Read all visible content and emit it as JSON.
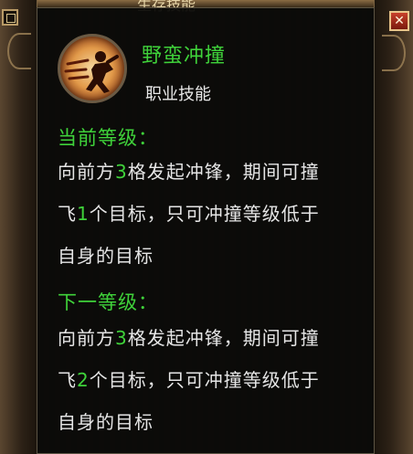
{
  "window": {
    "title_fragment": "生存技能",
    "close_glyph": "✕"
  },
  "skill": {
    "name": "野蛮冲撞",
    "type": "职业技能",
    "icon": "charging-warrior-icon"
  },
  "current_level": {
    "heading": "当前等级：",
    "desc_a": "向前方",
    "range": "3",
    "desc_b": "格发起冲锋，期间可撞",
    "desc_c": "飞",
    "targets": "1",
    "desc_d": "个目标，只可冲撞等级低于",
    "desc_e": "自身的目标"
  },
  "next_level": {
    "heading": "下一等级：",
    "desc_a": "向前方",
    "range": "3",
    "desc_b": "格发起冲锋，期间可撞",
    "desc_c": "飞",
    "targets": "2",
    "desc_d": "个目标，只可冲撞等级低于",
    "desc_e": "自身的目标"
  },
  "colors": {
    "highlight": "#3fd23a",
    "body_text": "#e6e6e6",
    "panel_bg": "#0a0a08"
  }
}
